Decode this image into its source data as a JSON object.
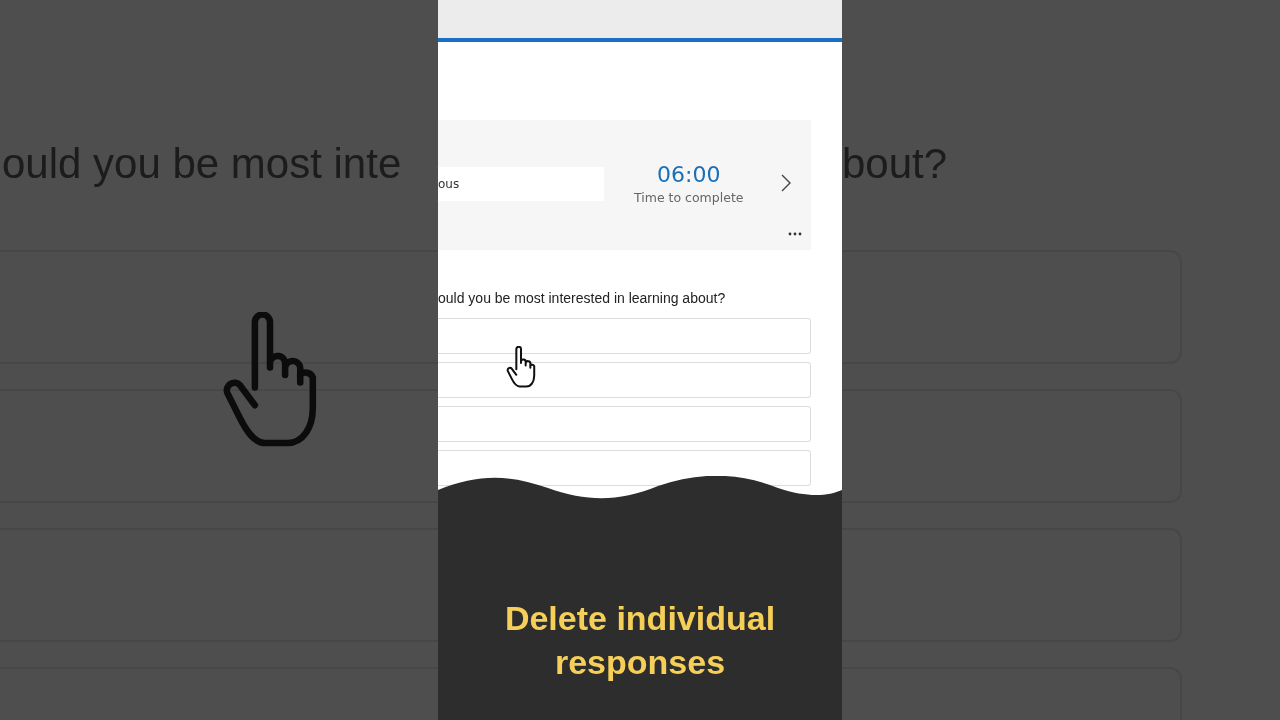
{
  "background": {
    "question_start": "ould you be most inte",
    "question_end": "bout?"
  },
  "panel": {
    "name_field": {
      "value": "ous"
    },
    "timer": {
      "value": "06:00",
      "label": "Time to complete"
    },
    "question": "ould you be most interested in learning about?"
  },
  "caption": "Delete individual responses"
}
